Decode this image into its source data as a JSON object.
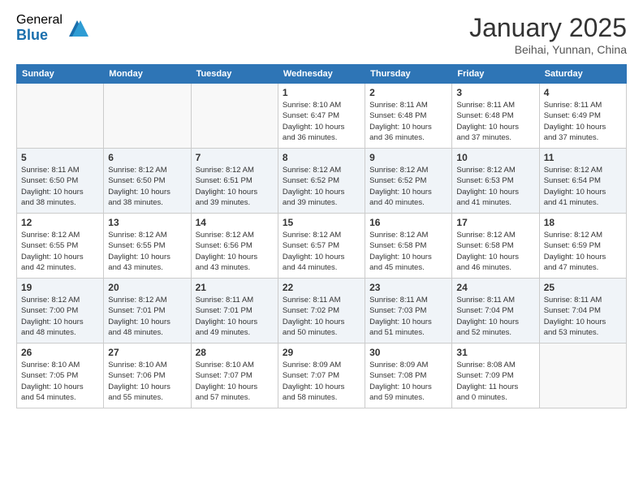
{
  "logo": {
    "general": "General",
    "blue": "Blue"
  },
  "header": {
    "month": "January 2025",
    "location": "Beihai, Yunnan, China"
  },
  "weekdays": [
    "Sunday",
    "Monday",
    "Tuesday",
    "Wednesday",
    "Thursday",
    "Friday",
    "Saturday"
  ],
  "weeks": [
    [
      {
        "day": "",
        "info": ""
      },
      {
        "day": "",
        "info": ""
      },
      {
        "day": "",
        "info": ""
      },
      {
        "day": "1",
        "info": "Sunrise: 8:10 AM\nSunset: 6:47 PM\nDaylight: 10 hours\nand 36 minutes."
      },
      {
        "day": "2",
        "info": "Sunrise: 8:11 AM\nSunset: 6:48 PM\nDaylight: 10 hours\nand 36 minutes."
      },
      {
        "day": "3",
        "info": "Sunrise: 8:11 AM\nSunset: 6:48 PM\nDaylight: 10 hours\nand 37 minutes."
      },
      {
        "day": "4",
        "info": "Sunrise: 8:11 AM\nSunset: 6:49 PM\nDaylight: 10 hours\nand 37 minutes."
      }
    ],
    [
      {
        "day": "5",
        "info": "Sunrise: 8:11 AM\nSunset: 6:50 PM\nDaylight: 10 hours\nand 38 minutes."
      },
      {
        "day": "6",
        "info": "Sunrise: 8:12 AM\nSunset: 6:50 PM\nDaylight: 10 hours\nand 38 minutes."
      },
      {
        "day": "7",
        "info": "Sunrise: 8:12 AM\nSunset: 6:51 PM\nDaylight: 10 hours\nand 39 minutes."
      },
      {
        "day": "8",
        "info": "Sunrise: 8:12 AM\nSunset: 6:52 PM\nDaylight: 10 hours\nand 39 minutes."
      },
      {
        "day": "9",
        "info": "Sunrise: 8:12 AM\nSunset: 6:52 PM\nDaylight: 10 hours\nand 40 minutes."
      },
      {
        "day": "10",
        "info": "Sunrise: 8:12 AM\nSunset: 6:53 PM\nDaylight: 10 hours\nand 41 minutes."
      },
      {
        "day": "11",
        "info": "Sunrise: 8:12 AM\nSunset: 6:54 PM\nDaylight: 10 hours\nand 41 minutes."
      }
    ],
    [
      {
        "day": "12",
        "info": "Sunrise: 8:12 AM\nSunset: 6:55 PM\nDaylight: 10 hours\nand 42 minutes."
      },
      {
        "day": "13",
        "info": "Sunrise: 8:12 AM\nSunset: 6:55 PM\nDaylight: 10 hours\nand 43 minutes."
      },
      {
        "day": "14",
        "info": "Sunrise: 8:12 AM\nSunset: 6:56 PM\nDaylight: 10 hours\nand 43 minutes."
      },
      {
        "day": "15",
        "info": "Sunrise: 8:12 AM\nSunset: 6:57 PM\nDaylight: 10 hours\nand 44 minutes."
      },
      {
        "day": "16",
        "info": "Sunrise: 8:12 AM\nSunset: 6:58 PM\nDaylight: 10 hours\nand 45 minutes."
      },
      {
        "day": "17",
        "info": "Sunrise: 8:12 AM\nSunset: 6:58 PM\nDaylight: 10 hours\nand 46 minutes."
      },
      {
        "day": "18",
        "info": "Sunrise: 8:12 AM\nSunset: 6:59 PM\nDaylight: 10 hours\nand 47 minutes."
      }
    ],
    [
      {
        "day": "19",
        "info": "Sunrise: 8:12 AM\nSunset: 7:00 PM\nDaylight: 10 hours\nand 48 minutes."
      },
      {
        "day": "20",
        "info": "Sunrise: 8:12 AM\nSunset: 7:01 PM\nDaylight: 10 hours\nand 48 minutes."
      },
      {
        "day": "21",
        "info": "Sunrise: 8:11 AM\nSunset: 7:01 PM\nDaylight: 10 hours\nand 49 minutes."
      },
      {
        "day": "22",
        "info": "Sunrise: 8:11 AM\nSunset: 7:02 PM\nDaylight: 10 hours\nand 50 minutes."
      },
      {
        "day": "23",
        "info": "Sunrise: 8:11 AM\nSunset: 7:03 PM\nDaylight: 10 hours\nand 51 minutes."
      },
      {
        "day": "24",
        "info": "Sunrise: 8:11 AM\nSunset: 7:04 PM\nDaylight: 10 hours\nand 52 minutes."
      },
      {
        "day": "25",
        "info": "Sunrise: 8:11 AM\nSunset: 7:04 PM\nDaylight: 10 hours\nand 53 minutes."
      }
    ],
    [
      {
        "day": "26",
        "info": "Sunrise: 8:10 AM\nSunset: 7:05 PM\nDaylight: 10 hours\nand 54 minutes."
      },
      {
        "day": "27",
        "info": "Sunrise: 8:10 AM\nSunset: 7:06 PM\nDaylight: 10 hours\nand 55 minutes."
      },
      {
        "day": "28",
        "info": "Sunrise: 8:10 AM\nSunset: 7:07 PM\nDaylight: 10 hours\nand 57 minutes."
      },
      {
        "day": "29",
        "info": "Sunrise: 8:09 AM\nSunset: 7:07 PM\nDaylight: 10 hours\nand 58 minutes."
      },
      {
        "day": "30",
        "info": "Sunrise: 8:09 AM\nSunset: 7:08 PM\nDaylight: 10 hours\nand 59 minutes."
      },
      {
        "day": "31",
        "info": "Sunrise: 8:08 AM\nSunset: 7:09 PM\nDaylight: 11 hours\nand 0 minutes."
      },
      {
        "day": "",
        "info": ""
      }
    ]
  ]
}
